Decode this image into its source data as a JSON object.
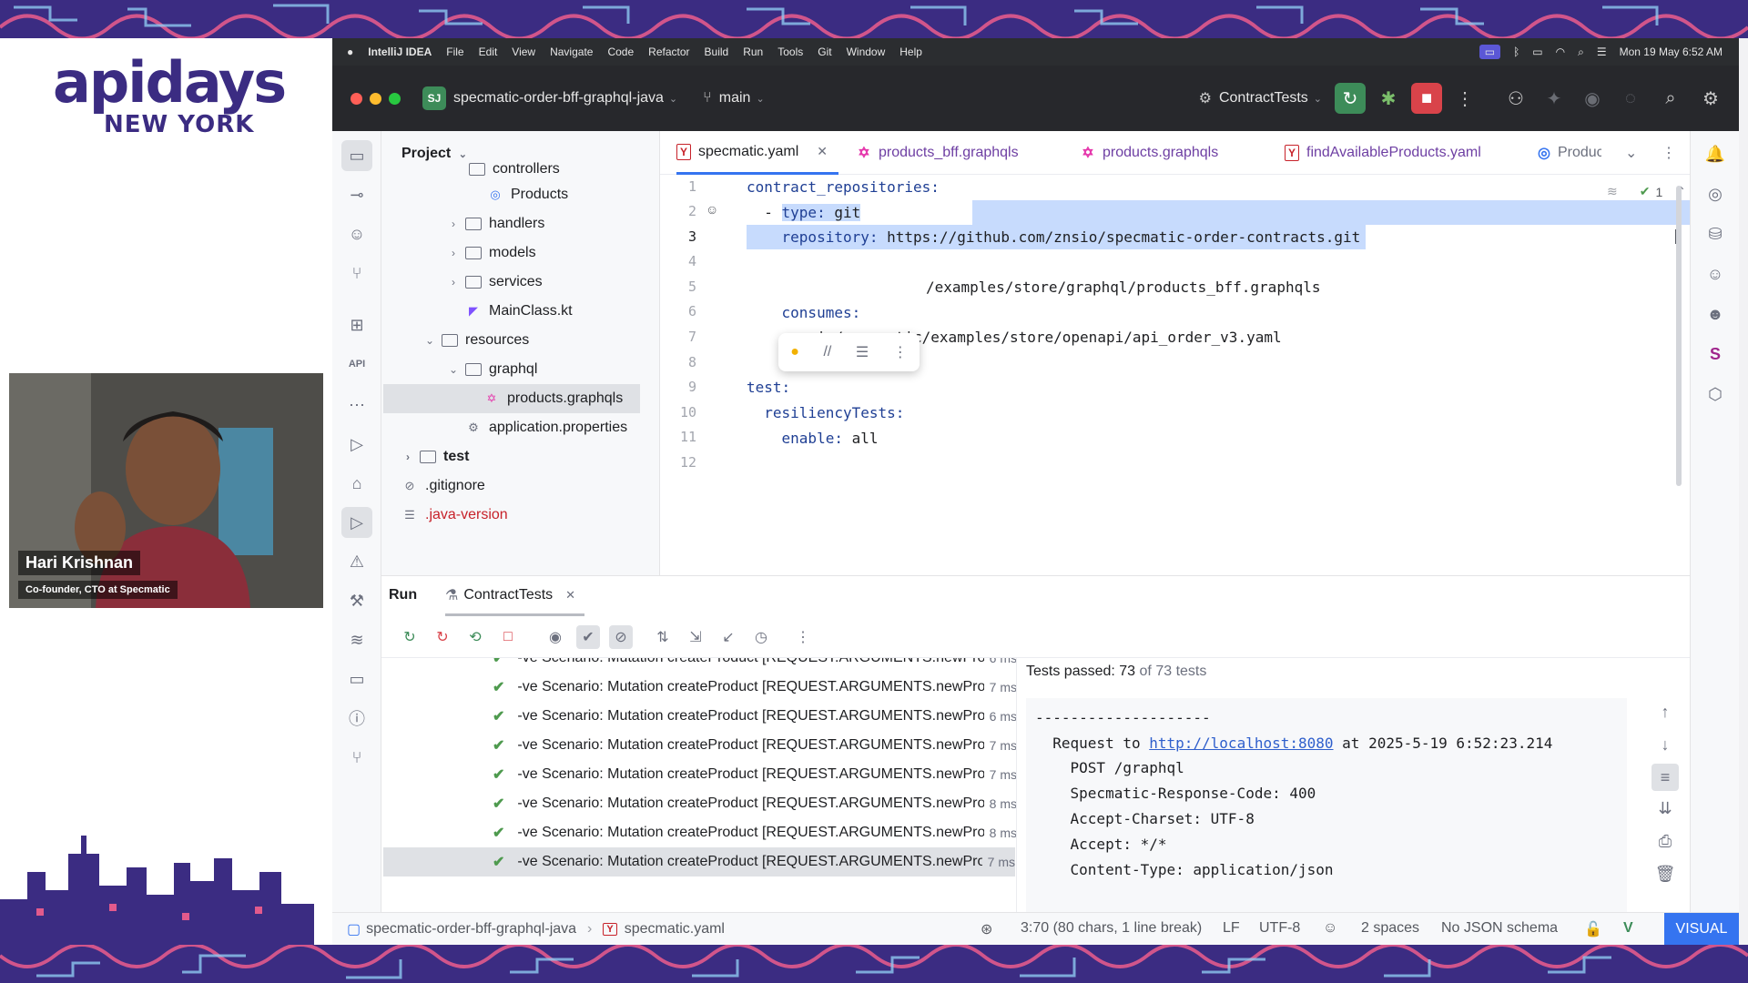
{
  "event": {
    "logo_main": "apidays",
    "logo_sub": "NEW YORK"
  },
  "speaker": {
    "name": "Hari Krishnan",
    "role": "Co-founder, CTO at Specmatic"
  },
  "menubar": {
    "app": "IntelliJ IDEA",
    "items": [
      "File",
      "Edit",
      "View",
      "Navigate",
      "Code",
      "Refactor",
      "Build",
      "Run",
      "Tools",
      "Git",
      "Window",
      "Help"
    ],
    "datetime": "Mon 19 May  6:52 AM"
  },
  "titlebar": {
    "project_badge": "SJ",
    "project_name": "specmatic-order-bff-graphql-java",
    "branch": "main",
    "run_config": "ContractTests"
  },
  "project_panel": {
    "title": "Project",
    "rows": [
      {
        "label": "controllers",
        "kind": "folder",
        "expanded": true
      },
      {
        "label": "Products",
        "kind": "class"
      },
      {
        "label": "handlers",
        "kind": "folder",
        "expanded": false
      },
      {
        "label": "models",
        "kind": "folder",
        "expanded": false
      },
      {
        "label": "services",
        "kind": "folder",
        "expanded": false
      },
      {
        "label": "MainClass.kt",
        "kind": "kotlin"
      },
      {
        "label": "resources",
        "kind": "folder",
        "expanded": true
      },
      {
        "label": "graphql",
        "kind": "folder",
        "expanded": true
      },
      {
        "label": "products.graphqls",
        "kind": "graphql",
        "selected": true
      },
      {
        "label": "application.properties",
        "kind": "properties"
      },
      {
        "label": "test",
        "kind": "folder",
        "expanded": false
      },
      {
        "label": ".gitignore",
        "kind": "ignore"
      },
      {
        "label": ".java-version",
        "kind": "text"
      }
    ]
  },
  "editor": {
    "tabs": [
      {
        "label": "specmatic.yaml",
        "icon": "yaml-icon",
        "active": true
      },
      {
        "label": "products_bff.graphqls",
        "icon": "graphql-icon"
      },
      {
        "label": "products.graphqls",
        "icon": "graphql-icon"
      },
      {
        "label": "findAvailableProducts.yaml",
        "icon": "yaml-icon"
      },
      {
        "label": "Produc",
        "icon": "class-icon"
      }
    ],
    "inspection_count": "1",
    "line_numbers": [
      "1",
      "2",
      "3",
      "4",
      "5",
      "6",
      "7",
      "8",
      "9",
      "10",
      "11",
      "12"
    ],
    "lines": {
      "l1_key": "contract_repositories:",
      "l2_dash": "  - ",
      "l2_key": "type:",
      "l2_val": " git",
      "l3_key": "    repository:",
      "l3_val": " https://github.com/znsio/specmatic-order-contracts.git",
      "l5_val": "/examples/store/graphql/products_bff.graphqls",
      "l6_key": "    consumes:",
      "l7_val": "      - io/specmatic/examples/store/openapi/api_order_v3.yaml",
      "l9_key": "test:",
      "l10_key": "  resiliencyTests:",
      "l11_key": "    enable:",
      "l11_val": " all"
    }
  },
  "run_panel": {
    "title": "Run",
    "tab": "ContractTests",
    "tests": [
      {
        "name": "-ve Scenario: Mutation createProduct [REQUEST.ARGUMENTS.newProduct",
        "time": "6 ms"
      },
      {
        "name": "-ve Scenario: Mutation createProduct [REQUEST.ARGUMENTS.newProduct",
        "time": "7 ms"
      },
      {
        "name": "-ve Scenario: Mutation createProduct [REQUEST.ARGUMENTS.newProduct",
        "time": "6 ms"
      },
      {
        "name": "-ve Scenario: Mutation createProduct [REQUEST.ARGUMENTS.newProduct",
        "time": "7 ms"
      },
      {
        "name": "-ve Scenario: Mutation createProduct [REQUEST.ARGUMENTS.newProduct",
        "time": "7 ms"
      },
      {
        "name": "-ve Scenario: Mutation createProduct [REQUEST.ARGUMENTS.newProduct",
        "time": "8 ms"
      },
      {
        "name": "-ve Scenario: Mutation createProduct [REQUEST.ARGUMENTS.newProduct",
        "time": "8 ms"
      },
      {
        "name": "-ve Scenario: Mutation createProduct [REQUEST.ARGUMENTS.newProduct",
        "time": "7 ms"
      }
    ],
    "passed_label": "Tests passed: 73",
    "passed_total": "of 73 tests",
    "console": {
      "divider": "--------------------",
      "req_prefix": "  Request to ",
      "req_url": "http://localhost:8080",
      "req_suffix": " at 2025-5-19 6:52:23.214",
      "lines": [
        "    POST /graphql",
        "    Specmatic-Response-Code: 400",
        "    Accept-Charset: UTF-8",
        "    Accept: */*",
        "    Content-Type: application/json"
      ]
    }
  },
  "statusbar": {
    "project": "specmatic-order-bff-graphql-java",
    "file": "specmatic.yaml",
    "position": "3:70 (80 chars, 1 line break)",
    "line_sep": "LF",
    "encoding": "UTF-8",
    "indent": "2 spaces",
    "schema": "No JSON schema",
    "mode": "VISUAL"
  },
  "colors": {
    "accent": "#3574f0",
    "selection": "#c7dbfd",
    "brand": "#3b2c82",
    "success": "#4e9a4e"
  }
}
